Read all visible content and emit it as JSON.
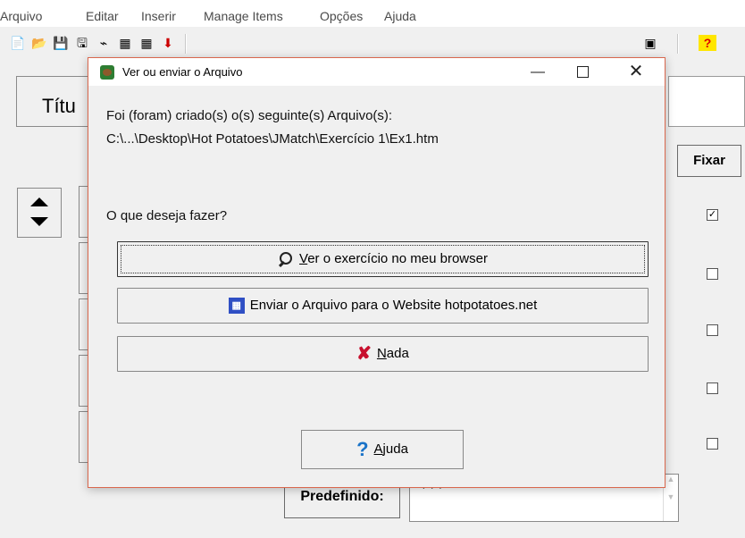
{
  "menubar": {
    "items": [
      "Arquivo",
      "Editar",
      "Inserir",
      "Manage Items",
      "Opções",
      "Ajuda"
    ]
  },
  "background": {
    "title_label": "Títu",
    "fixar_label": "Fixar",
    "predefinido_label": "Predefinido:",
    "predefinido_value": "???",
    "checkboxes": [
      true,
      false,
      false,
      false,
      false
    ]
  },
  "dialog": {
    "title": "Ver ou enviar o Arquivo",
    "minimize_glyph": "—",
    "close_glyph": "✕",
    "created_text": "Foi (foram) criado(s) o(s) seguinte(s) Arquivo(s):",
    "file_path": "C:\\...\\Desktop\\Hot Potatoes\\JMatch\\Exercício 1\\Ex1.htm",
    "question": "O que deseja fazer?",
    "btn_ver": {
      "mnemonic": "V",
      "rest": "er o exercício no meu browser"
    },
    "btn_enviar": "Enviar o Arquivo para o Website hotpotatoes.net",
    "btn_nada": {
      "mnemonic": "N",
      "rest": "ada"
    },
    "btn_ajuda": {
      "mnemonic": "A",
      "rest": "juda"
    }
  }
}
